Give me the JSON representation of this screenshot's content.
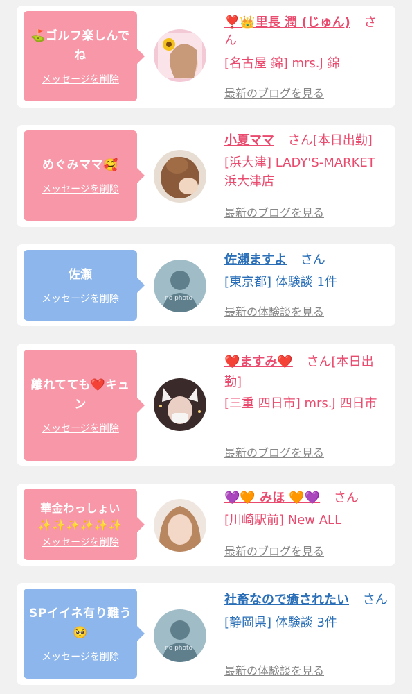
{
  "delete_label": "メッセージを削除",
  "colors": {
    "pink_bubble": "#f797a7",
    "blue_bubble": "#8cb6ec",
    "pink_text": "#e94a6d",
    "blue_text": "#2a6fb8",
    "link_gray": "#888888"
  },
  "cards": [
    {
      "bubble_title": "⛳ゴルフ楽しんでね",
      "name": "❣️👑里長 潤 (じゅん)",
      "honorific": "さん",
      "detail": "[名古屋 錦] mrs.J 錦",
      "link": "最新のブログを見る",
      "avatar_icon": "sunflower-photo"
    },
    {
      "bubble_title": "めぐみママ🥰",
      "name": "小夏ママ",
      "honorific": "さん[本日出勤]",
      "detail": "[浜大津] LADY'S-MARKET 浜大津店",
      "link": "最新のブログを見る",
      "avatar_icon": "hair-photo"
    },
    {
      "bubble_title": "佐瀬",
      "name": "佐瀬ますよ",
      "honorific": "さん",
      "detail": "[東京都] 体験談 1件",
      "link": "最新の体験談を見る",
      "avatar_icon": "no-photo",
      "avatar_text": "no photo"
    },
    {
      "bubble_title": "離れてても❤️キュン",
      "name": "❤️ますみ❤️",
      "honorific": "さん[本日出勤]",
      "detail": "[三重 四日市] mrs.J 四日市",
      "link": "最新のブログを見る",
      "avatar_icon": "cat-ears-photo"
    },
    {
      "bubble_title": "華金わっしょい✨✨✨✨✨✨",
      "name": "💜🧡 みほ 🧡💜",
      "honorific": "さん",
      "detail": "[川崎駅前] New ALL",
      "link": "最新のブログを見る",
      "avatar_icon": "portrait-photo"
    },
    {
      "bubble_title": "SPイイネ有り難う🥺",
      "name": "社畜なので癒されたい",
      "honorific": "さん",
      "detail": "[静岡県] 体験談 3件",
      "link": "最新の体験談を見る",
      "avatar_icon": "no-photo",
      "avatar_text": "no photo"
    }
  ]
}
